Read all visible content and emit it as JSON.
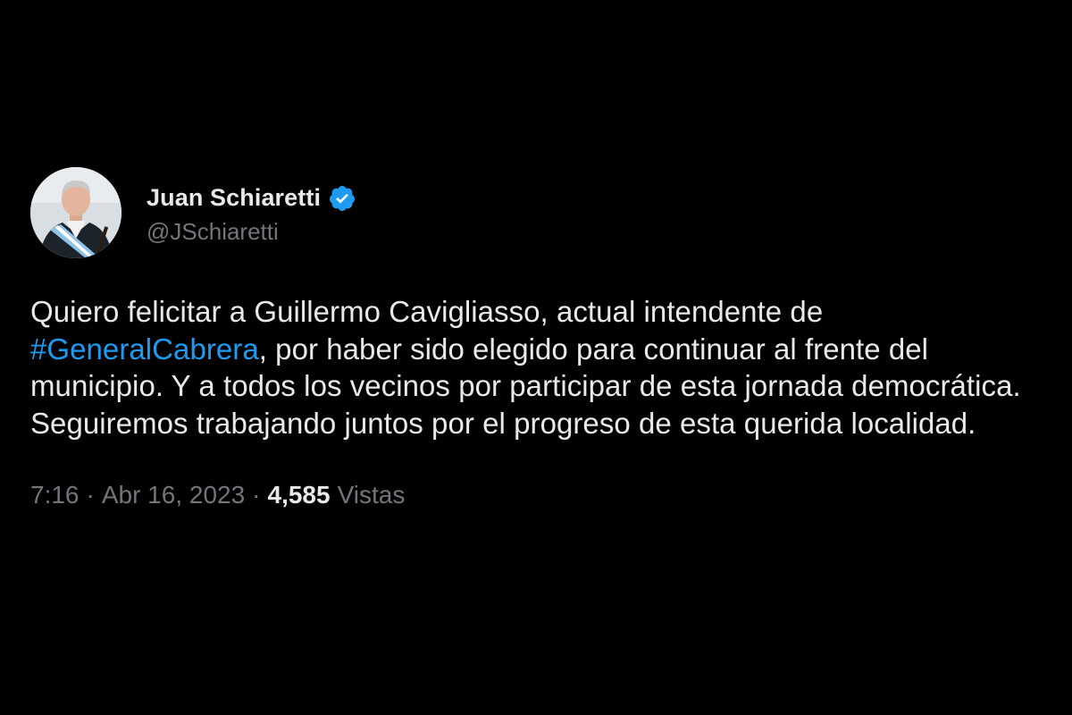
{
  "author": {
    "display_name": "Juan Schiaretti",
    "handle": "@JSchiaretti",
    "verified": true,
    "avatar_icon": "portrait-avatar",
    "verified_icon": "verified-badge-icon"
  },
  "tweet": {
    "text_before": "Quiero felicitar a Guillermo Cavigliasso, actual intendente de ",
    "hashtag": "#GeneralCabrera",
    "text_after": ", por haber sido elegido para continuar al frente del municipio. Y a todos los vecinos por participar de esta jornada democrática. Seguiremos trabajando juntos por el progreso de esta querida localidad."
  },
  "meta": {
    "time": "7:16",
    "separator": "·",
    "date": "Abr 16, 2023",
    "views_count": "4,585",
    "views_label": "Vistas"
  },
  "colors": {
    "background": "#000000",
    "text": "#e7e9ea",
    "secondary": "#71767b",
    "link": "#1d9bf0"
  }
}
